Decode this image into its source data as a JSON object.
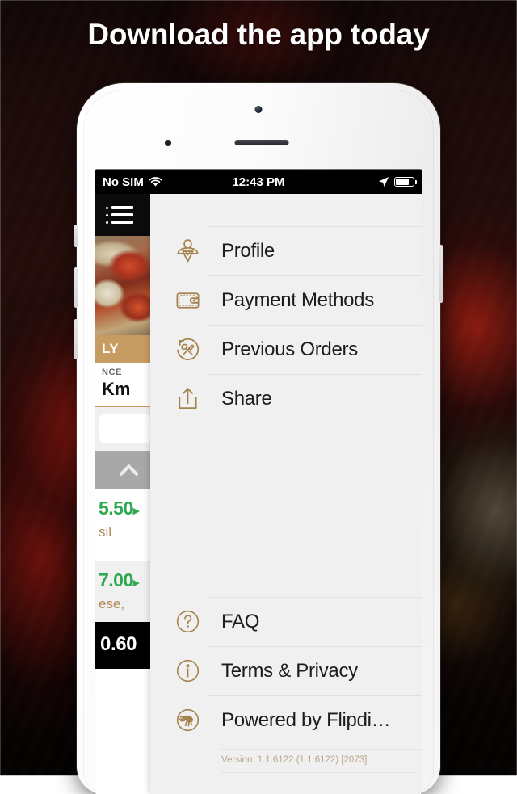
{
  "promo": {
    "headline": "Download the app today"
  },
  "status_bar": {
    "carrier": "No SIM",
    "wifi_icon": "wifi-icon",
    "time": "12:43 PM",
    "location_icon": "location-arrow-icon",
    "battery_icon": "battery-icon"
  },
  "app_background": {
    "menu_button_icon": "hamburger-menu-icon",
    "ribbon_text": "LY",
    "distance_label": "NCE",
    "distance_value": "Km",
    "collapse_icon": "chevron-up-icon",
    "items": [
      {
        "price": "5.50",
        "arrow": "▸",
        "desc": "sil"
      },
      {
        "price": "7.00",
        "arrow": "▸",
        "desc": "ese,"
      }
    ],
    "total": "0.60"
  },
  "drawer": {
    "primary_items": [
      {
        "label": "Profile",
        "icon": "profile-icon"
      },
      {
        "label": "Payment Methods",
        "icon": "wallet-icon"
      },
      {
        "label": "Previous Orders",
        "icon": "previous-orders-icon"
      },
      {
        "label": "Share",
        "icon": "share-icon"
      }
    ],
    "secondary_items": [
      {
        "label": "FAQ",
        "icon": "question-mark-icon"
      },
      {
        "label": "Terms & Privacy",
        "icon": "info-icon"
      },
      {
        "label": "Powered  by Flipdi…",
        "icon": "flipdish-logo-icon"
      }
    ],
    "version": "Version: 1.1.6122 (1.1.6122) [2073]"
  },
  "colors": {
    "accent_gold": "#a5814c",
    "drawer_background": "#f0f0f0",
    "ribbon_gold": "#c79c62",
    "price_green": "#2fa84f",
    "text_dark": "#1c1c1c",
    "version_text": "#b9a68c"
  }
}
